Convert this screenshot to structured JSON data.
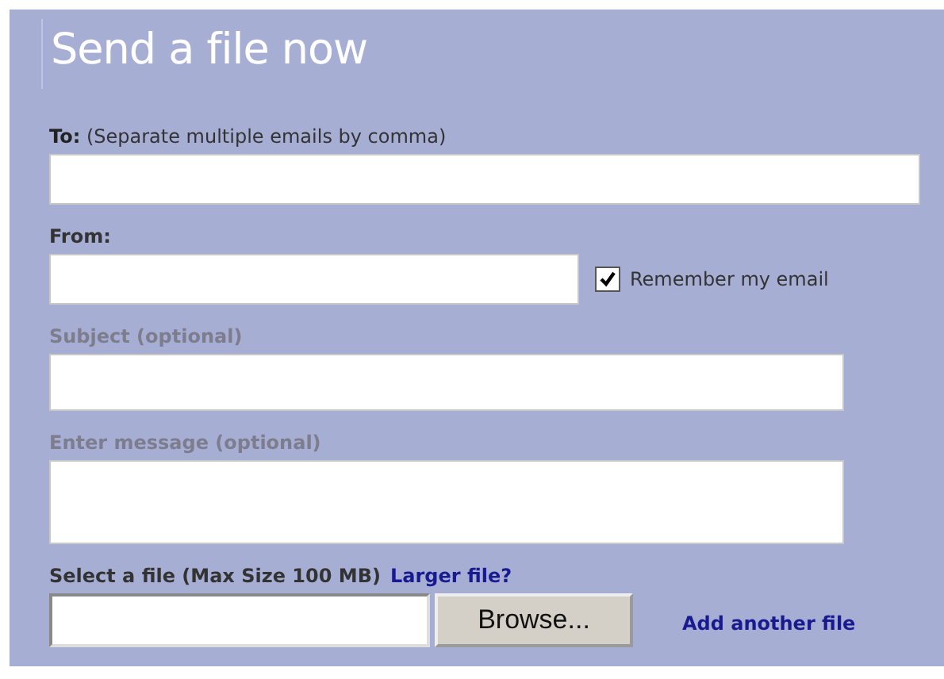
{
  "title": "Send a file now",
  "fields": [
    {
      "kind": "text",
      "label": "**To:** (Separate multiple emails by comma)",
      "muted": false
    },
    {
      "kind": "text",
      "label": "From:",
      "muted": false,
      "checkbox": {
        "label": "Remember my email",
        "checked": true
      }
    },
    {
      "kind": "text",
      "label": "Subject (optional)",
      "muted": true
    },
    {
      "kind": "textarea",
      "label": "Enter message (optional)",
      "muted": true
    },
    {
      "kind": "file",
      "label": "Select a file (Max Size 100 MB)",
      "link": "Larger file?",
      "muted": false,
      "button": "Browse...",
      "side_link": "Add another file"
    }
  ]
}
